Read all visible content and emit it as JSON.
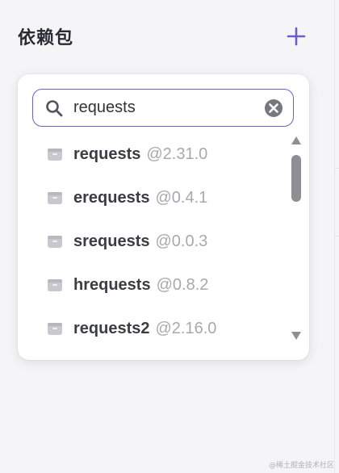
{
  "header": {
    "title": "依赖包",
    "add_icon": "plus-icon"
  },
  "search": {
    "value": "requests",
    "search_icon": "search-icon",
    "clear_icon": "clear-circle-icon"
  },
  "packages": [
    {
      "name": "requests",
      "version": "@2.31.0"
    },
    {
      "name": "erequests",
      "version": "@0.4.1"
    },
    {
      "name": "srequests",
      "version": "@0.0.3"
    },
    {
      "name": "hrequests",
      "version": "@0.8.2"
    },
    {
      "name": "requests2",
      "version": "@2.16.0"
    }
  ],
  "scrollbar": {
    "up_icon": "triangle-up-icon",
    "down_icon": "triangle-down-icon"
  },
  "watermark": "@稀土掘金技术社区",
  "colors": {
    "accent": "#6a5fc8",
    "title": "#2a2a32",
    "package_name": "#3c3c44",
    "version": "#a8a8b0",
    "background": "#f5f5f8"
  }
}
